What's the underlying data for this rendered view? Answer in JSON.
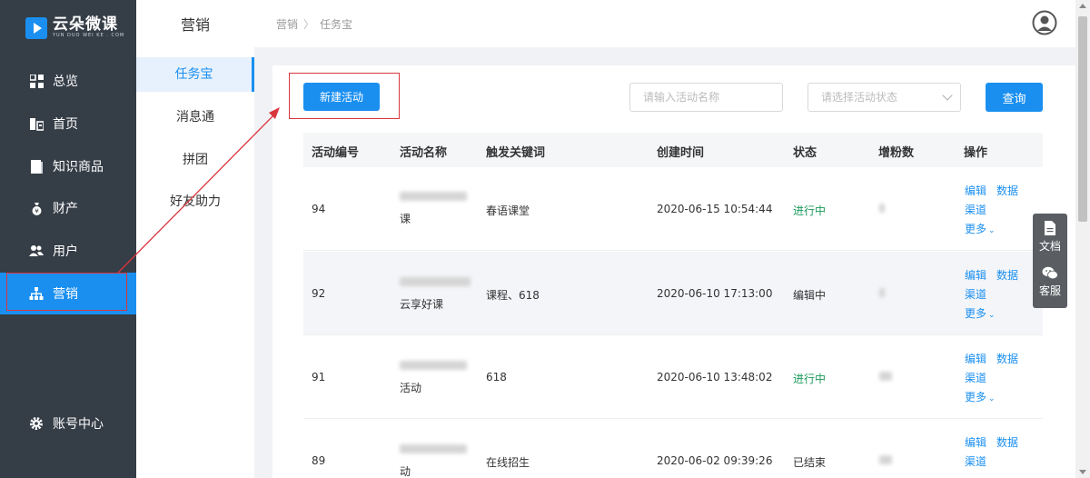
{
  "app": {
    "logo_title": "云朵微课",
    "logo_sub": "YUN DUO WEI KE . COM"
  },
  "sidebar": {
    "items": [
      {
        "label": "总览",
        "icon": "dashboard-icon"
      },
      {
        "label": "首页",
        "icon": "home-icon"
      },
      {
        "label": "知识商品",
        "icon": "book-icon"
      },
      {
        "label": "财产",
        "icon": "money-bag-icon"
      },
      {
        "label": "用户",
        "icon": "users-icon"
      },
      {
        "label": "营销",
        "icon": "org-chart-icon"
      }
    ],
    "account_label": "账号中心"
  },
  "submenu": {
    "title": "营销",
    "items": [
      "任务宝",
      "消息通",
      "拼团",
      "好友助力"
    ]
  },
  "breadcrumb": {
    "parent": "营销",
    "current": "任务宝"
  },
  "toolbar": {
    "new_button": "新建活动",
    "name_placeholder": "请输入活动名称",
    "status_placeholder": "请选择活动状态",
    "search_button": "查询"
  },
  "table": {
    "columns": [
      "活动编号",
      "活动名称",
      "触发关键词",
      "创建时间",
      "状态",
      "增粉数",
      "操作"
    ],
    "rows": [
      {
        "id": "94",
        "name_visible": "课",
        "keyword": "春语课堂",
        "created": "2020-06-15 10:54:44",
        "status": "进行中"
      },
      {
        "id": "92",
        "name_visible": "云享好课",
        "keyword": "课程、618",
        "created": "2020-06-10 17:13:00",
        "status": "编辑中"
      },
      {
        "id": "91",
        "name_visible": "活动",
        "keyword": "618",
        "created": "2020-06-10 13:48:02",
        "status": "进行中"
      },
      {
        "id": "89",
        "name_visible": "动",
        "keyword": "在线招生",
        "created": "2020-06-02 09:39:26",
        "status": "已结束"
      }
    ],
    "ops": {
      "edit": "编辑",
      "data": "数据",
      "channel": "渠道",
      "more": "更多"
    }
  },
  "float_widget": {
    "doc_label": "文档",
    "service_label": "客服"
  },
  "colors": {
    "primary": "#1a8ff0",
    "sidebar_bg": "#353d47",
    "highlight": "#d9363e",
    "status_active": "#1a9a5a"
  }
}
